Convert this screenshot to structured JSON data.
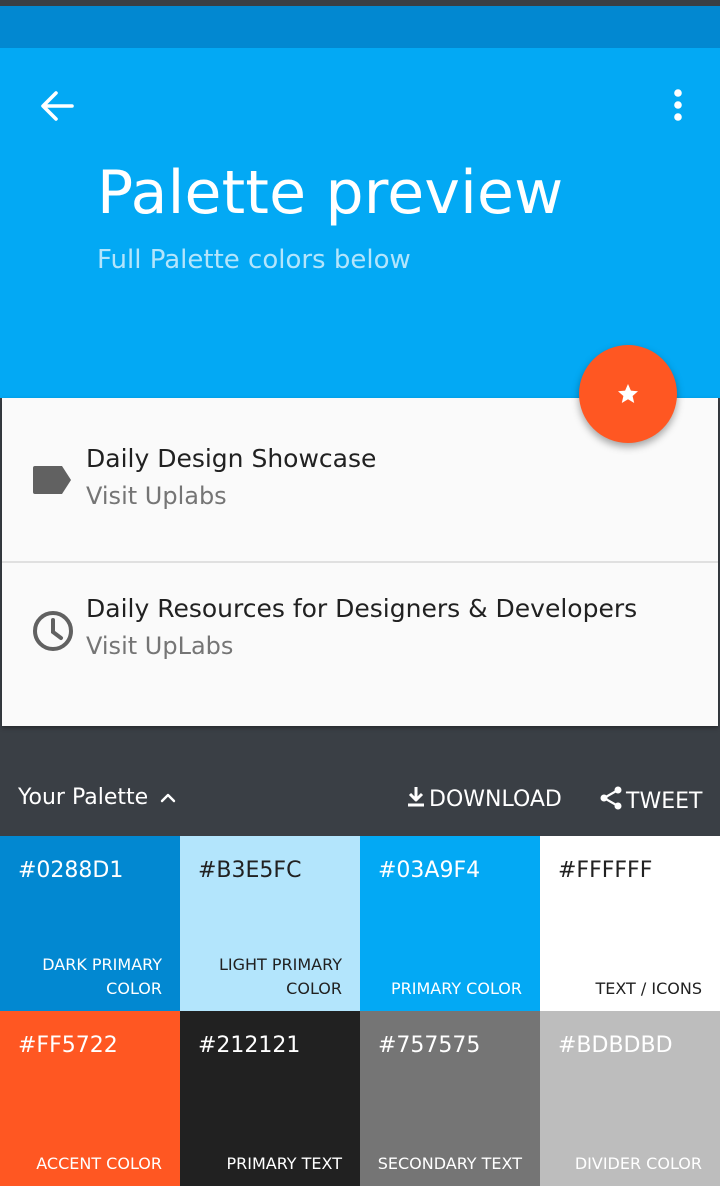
{
  "header": {
    "title": "Palette preview",
    "subtitle": "Full Palette colors below",
    "color_primary": "#03A9F4",
    "color_dark": "#0288D1"
  },
  "icons": {
    "back": "arrow-back-icon",
    "more": "more-vert-icon",
    "fab": "star-icon",
    "row1": "label-icon",
    "row2": "clock-icon",
    "download": "download-icon",
    "share": "share-icon",
    "chevron": "chevron-up-icon"
  },
  "list": {
    "items": [
      {
        "title": "Daily Design Showcase",
        "subtitle": "Visit Uplabs"
      },
      {
        "title": "Daily Resources for Designers & Developers",
        "subtitle": "Visit UpLabs"
      }
    ]
  },
  "palette": {
    "label": "Your Palette",
    "download_label": "DOWNLOAD",
    "tweet_label": "TWEET",
    "swatches": [
      {
        "hex": "#0288D1",
        "name": "DARK PRIMARY COLOR",
        "bg": "#0288D1",
        "fg": "#ffffff"
      },
      {
        "hex": "#B3E5FC",
        "name": "LIGHT PRIMARY COLOR",
        "bg": "#B3E5FC",
        "fg": "#212121"
      },
      {
        "hex": "#03A9F4",
        "name": "PRIMARY COLOR",
        "bg": "#03A9F4",
        "fg": "#ffffff"
      },
      {
        "hex": "#FFFFFF",
        "name": "TEXT / ICONS",
        "bg": "#FFFFFF",
        "fg": "#212121"
      },
      {
        "hex": "#FF5722",
        "name": "ACCENT COLOR",
        "bg": "#FF5722",
        "fg": "#ffffff"
      },
      {
        "hex": "#212121",
        "name": "PRIMARY TEXT",
        "bg": "#212121",
        "fg": "#ffffff"
      },
      {
        "hex": "#757575",
        "name": "SECONDARY TEXT",
        "bg": "#757575",
        "fg": "#ffffff"
      },
      {
        "hex": "#BDBDBD",
        "name": "DIVIDER COLOR",
        "bg": "#BDBDBD",
        "fg": "#ffffff"
      }
    ]
  }
}
